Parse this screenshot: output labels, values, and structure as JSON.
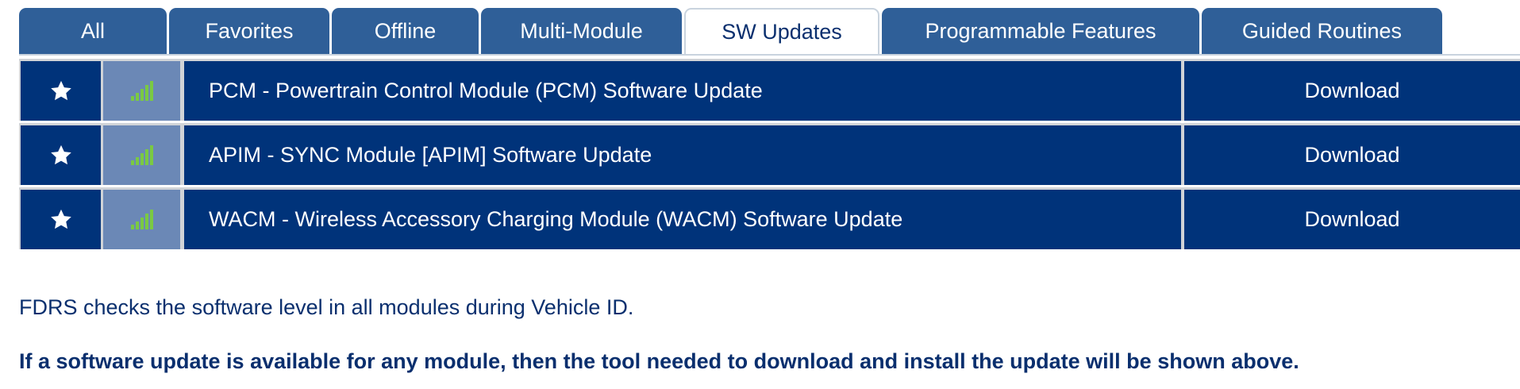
{
  "tabs": [
    {
      "label": "All",
      "width": 186
    },
    {
      "label": "Favorites",
      "width": 202
    },
    {
      "label": "Offline",
      "width": 185
    },
    {
      "label": "Multi-Module",
      "width": 253
    },
    {
      "label": "SW Updates",
      "width": 246
    },
    {
      "label": "Programmable Features",
      "width": 400
    },
    {
      "label": "Guided Routines",
      "width": 303
    }
  ],
  "active_tab": "SW Updates",
  "rows": [
    {
      "name": "PCM - Powertrain Control Module (PCM) Software Update",
      "action": "Download"
    },
    {
      "name": "APIM - SYNC Module [APIM] Software Update",
      "action": "Download"
    },
    {
      "name": "WACM - Wireless Accessory Charging Module (WACM) Software Update",
      "action": "Download"
    }
  ],
  "icons": {
    "favorite": "star-icon",
    "signal": "signal-bars-icon"
  },
  "colors": {
    "row_bg": "#00337a",
    "tab_bg": "#2f5f98",
    "signal_cell_bg": "#6b88b6",
    "signal_bars": "#7ac943",
    "text_blue": "#0a2f6e"
  },
  "notes": {
    "line1": "FDRS checks the software level in all modules during Vehicle ID.",
    "line2": "If a software update is available for any module, then the tool needed to download and install the update will be shown above."
  }
}
